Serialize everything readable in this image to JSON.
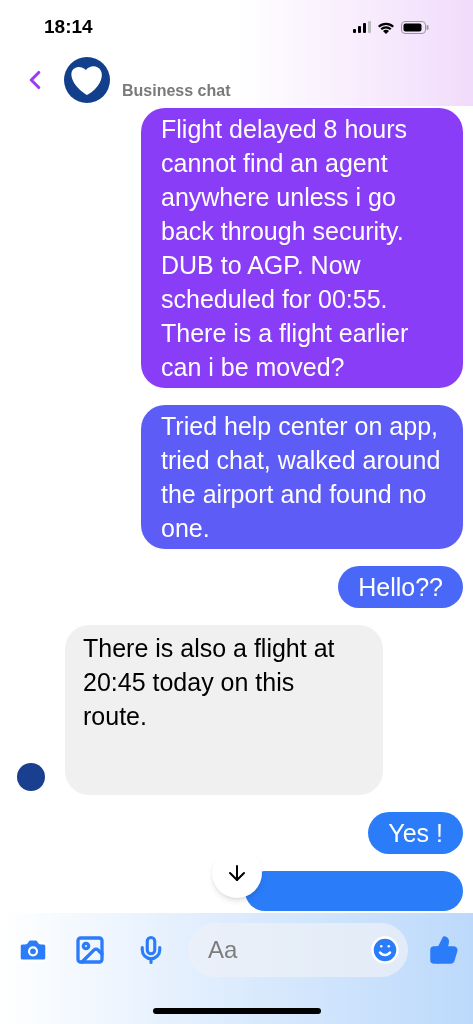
{
  "status_bar": {
    "time": "18:14"
  },
  "header": {
    "subtitle": "Business chat"
  },
  "messages": [
    {
      "kind": "outgoing",
      "text": "Flight delayed 8 hours cannot find an agent anywhere unless i go back through security. DUB to AGP. Now scheduled for 00:55. There is a flight earlier can i be moved?"
    },
    {
      "kind": "outgoing",
      "text": "Tried help center on app, tried chat, walked around the airport and found no one."
    },
    {
      "kind": "outgoing",
      "text": "Hello??"
    },
    {
      "kind": "incoming",
      "text": "There is also a flight at 20:45 today on this route."
    },
    {
      "kind": "outgoing",
      "text": "Yes !"
    }
  ],
  "composer": {
    "placeholder": "Aa"
  }
}
